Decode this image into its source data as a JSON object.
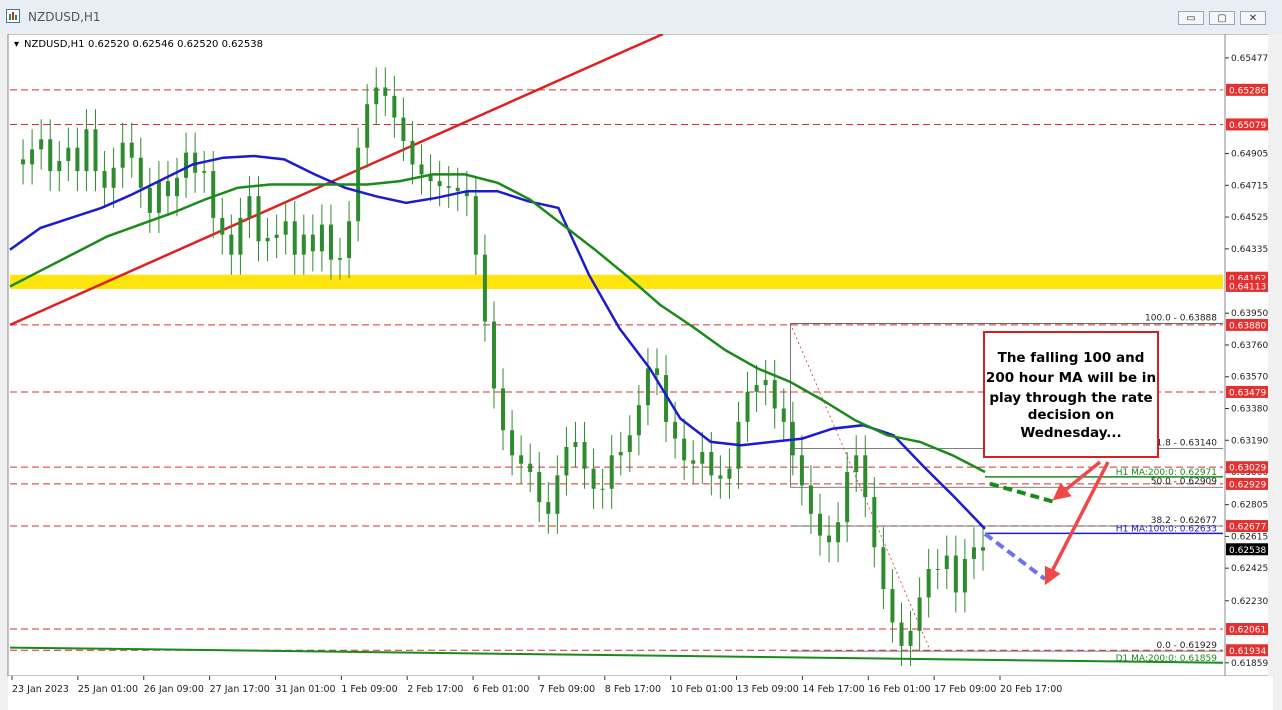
{
  "window": {
    "title": "NZDUSD,H1",
    "controls": {
      "minimize": "▭",
      "restore": "▢",
      "close": "✕"
    }
  },
  "chart_header": {
    "symbol": "NZDUSD,H1",
    "ohlc": "0.62520 0.62546 0.62520 0.62538"
  },
  "callout": {
    "lines": [
      "The falling 100 and",
      "200 hour MA will be in",
      "play through the rate",
      "decision on",
      "Wednesday..."
    ]
  },
  "colors": {
    "background": "#ffffff",
    "ma100": "#1b1bd1",
    "ma200": "#1a8a1a",
    "trendline": "#e02020",
    "level_line": "#d03030",
    "highlight_band": "#ffe400",
    "candle": "#2e8b2e",
    "arrow": "#f04848",
    "callout_border": "#d42020"
  },
  "chart_data": {
    "type": "candlestick",
    "symbol": "NZDUSD",
    "timeframe": "H1",
    "ylim": [
      0.6178,
      0.6562
    ],
    "y_ticks": [
      "0.65477",
      "0.64905",
      "0.64715",
      "0.64525",
      "0.64335",
      "0.63950",
      "0.63760",
      "0.63570",
      "0.63380",
      "0.63190",
      "0.63000",
      "0.62805",
      "0.62615",
      "0.62425",
      "0.62230",
      "0.61859"
    ],
    "x_ticks": [
      "23 Jan 2023",
      "25 Jan 01:00",
      "26 Jan 09:00",
      "27 Jan 17:00",
      "31 Jan 01:00",
      "1 Feb 09:00",
      "2 Feb 17:00",
      "6 Feb 01:00",
      "7 Feb 09:00",
      "8 Feb 17:00",
      "10 Feb 01:00",
      "13 Feb 09:00",
      "14 Feb 17:00",
      "16 Feb 01:00",
      "17 Feb 09:00",
      "20 Feb 17:00"
    ],
    "price_labels": [
      {
        "value": 0.65286,
        "text": "0.65286",
        "style": "red"
      },
      {
        "value": 0.65079,
        "text": "0.65079",
        "style": "red"
      },
      {
        "value": 0.64162,
        "text": "0.64162",
        "style": "red"
      },
      {
        "value": 0.64113,
        "text": "0.64113",
        "style": "red"
      },
      {
        "value": 0.6388,
        "text": "0.63880",
        "style": "red"
      },
      {
        "value": 0.63479,
        "text": "0.63479",
        "style": "red"
      },
      {
        "value": 0.63029,
        "text": "0.63029",
        "style": "red"
      },
      {
        "value": 0.62929,
        "text": "0.62929",
        "style": "red"
      },
      {
        "value": 0.62677,
        "text": "0.62677",
        "style": "red"
      },
      {
        "value": 0.62538,
        "text": "0.62538",
        "style": "black"
      },
      {
        "value": 0.62061,
        "text": "0.62061",
        "style": "red"
      },
      {
        "value": 0.61934,
        "text": "0.61934",
        "style": "red"
      }
    ],
    "horizontal_levels": [
      0.65286,
      0.65079,
      0.6388,
      0.63479,
      0.63029,
      0.62929,
      0.62677,
      0.62061,
      0.61934
    ],
    "yellow_band": [
      0.64113,
      0.64162
    ],
    "fibonacci": {
      "levels": [
        {
          "pct": "100.0",
          "value": 0.63888,
          "label": "100.0 - 0.63888"
        },
        {
          "pct": "61.8",
          "value": 0.6314,
          "label": "61.8 - 0.63140"
        },
        {
          "pct": "50.0",
          "value": 0.62909,
          "label": "50.0 - 0.62909"
        },
        {
          "pct": "38.2",
          "value": 0.62677,
          "label": "38.2 - 0.62677"
        },
        {
          "pct": "0.0",
          "value": 0.61929,
          "label": "0.0 - 0.61929"
        }
      ]
    },
    "indicator_labels": [
      {
        "text": "H1 MA:200:0: 0.62971",
        "value": 0.62971,
        "color": "#1a8a1a"
      },
      {
        "text": "H1 MA:100:0: 0.62633",
        "value": 0.62633,
        "color": "#1b1bd1"
      },
      {
        "text": "D1 MA:200:0: 0.61859",
        "value": 0.61859,
        "color": "#1a8a1a"
      }
    ],
    "series": [
      {
        "name": "H1 MA:100",
        "values": [
          0.6433,
          0.6446,
          0.6452,
          0.6458,
          0.6466,
          0.6475,
          0.6484,
          0.6488,
          0.6489,
          0.6487,
          0.6478,
          0.647,
          0.6465,
          0.6461,
          0.6464,
          0.6468,
          0.6468,
          0.6462,
          0.6458,
          0.6418,
          0.6386,
          0.6362,
          0.6332,
          0.6318,
          0.6316,
          0.6318,
          0.632,
          0.6326,
          0.6328,
          0.6322,
          0.6303,
          0.6285,
          0.6266
        ]
      },
      {
        "name": "H1 MA:200",
        "values": [
          0.6411,
          0.6421,
          0.6431,
          0.6441,
          0.6448,
          0.6455,
          0.6463,
          0.647,
          0.6472,
          0.6472,
          0.6472,
          0.6472,
          0.6474,
          0.6478,
          0.6478,
          0.6473,
          0.6463,
          0.6448,
          0.6433,
          0.6417,
          0.64,
          0.6387,
          0.6373,
          0.6362,
          0.6354,
          0.6343,
          0.6331,
          0.6322,
          0.6318,
          0.631,
          0.63
        ]
      }
    ],
    "price_path": [
      0.6487,
      0.6484,
      0.6493,
      0.6499,
      0.648,
      0.6486,
      0.6494,
      0.648,
      0.6505,
      0.648,
      0.647,
      0.6482,
      0.6497,
      0.6488,
      0.647,
      0.6455,
      0.6474,
      0.6465,
      0.6476,
      0.6491,
      0.6479,
      0.648,
      0.6452,
      0.6442,
      0.643,
      0.6452,
      0.6465,
      0.6438,
      0.644,
      0.6442,
      0.645,
      0.643,
      0.6442,
      0.6432,
      0.6448,
      0.6427,
      0.6428,
      0.645,
      0.6494,
      0.652,
      0.653,
      0.6525,
      0.6512,
      0.6498,
      0.6484,
      0.6478,
      0.6474,
      0.6471,
      0.647,
      0.6468,
      0.6465,
      0.643,
      0.639,
      0.635,
      0.6325,
      0.631,
      0.6305,
      0.63,
      0.6282,
      0.6275,
      0.6298,
      0.6315,
      0.6318,
      0.6302,
      0.629,
      0.629,
      0.631,
      0.6312,
      0.6322,
      0.634,
      0.6362,
      0.6358,
      0.633,
      0.632,
      0.6307,
      0.6305,
      0.6312,
      0.6298,
      0.6296,
      0.6302,
      0.633,
      0.6348,
      0.6352,
      0.6355,
      0.6338,
      0.633,
      0.631,
      0.6292,
      0.6275,
      0.6262,
      0.6258,
      0.627,
      0.63,
      0.631,
      0.6285,
      0.6255,
      0.623,
      0.621,
      0.6196,
      0.6205,
      0.6225,
      0.6242,
      0.6242,
      0.625,
      0.6228,
      0.6248,
      0.6255,
      0.6253
    ]
  }
}
